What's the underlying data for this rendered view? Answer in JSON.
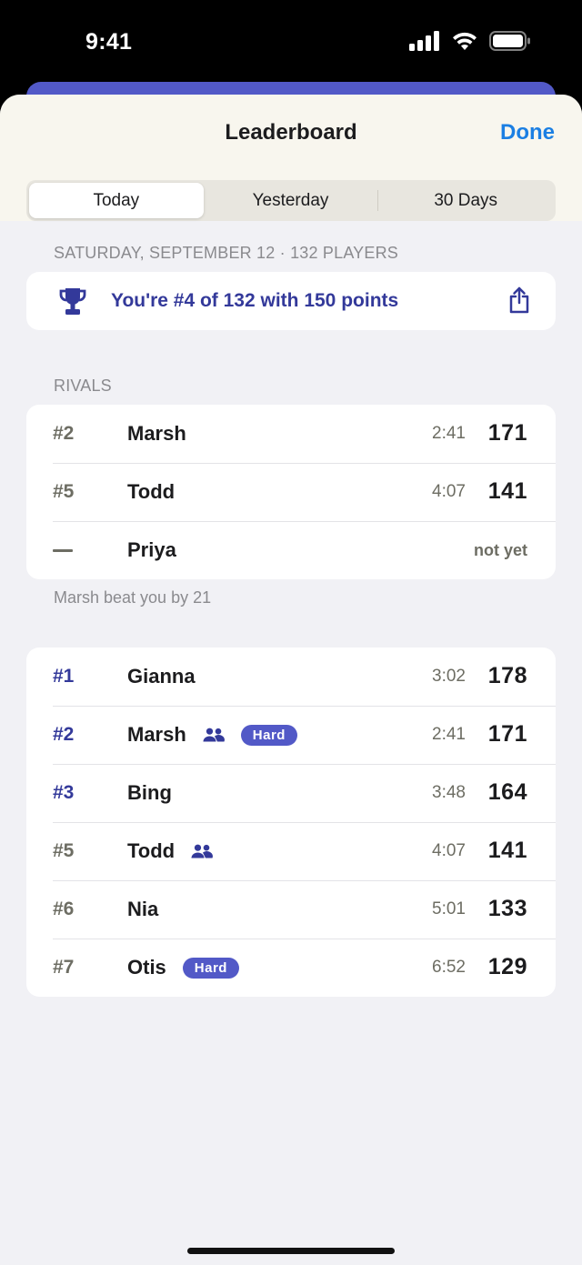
{
  "status_bar": {
    "time": "9:41"
  },
  "header": {
    "title": "Leaderboard",
    "done_label": "Done"
  },
  "tabs": [
    {
      "label": "Today",
      "selected": true
    },
    {
      "label": "Yesterday",
      "selected": false
    },
    {
      "label": "30 Days",
      "selected": false
    }
  ],
  "date_line": "SATURDAY, SEPTEMBER 12 · 132 PLAYERS",
  "summary": {
    "text": "You're #4 of 132 with 150 points"
  },
  "rivals": {
    "label": "RIVALS",
    "rows": [
      {
        "rank": "#2",
        "name": "Marsh",
        "time": "2:41",
        "score": "171"
      },
      {
        "rank": "#5",
        "name": "Todd",
        "time": "4:07",
        "score": "141"
      },
      {
        "rank": "",
        "name": "Priya",
        "status": "not yet"
      }
    ],
    "footnote": "Marsh beat you by 21"
  },
  "leaders": [
    {
      "rank": "#1",
      "name": "Gianna",
      "time": "3:02",
      "score": "178"
    },
    {
      "rank": "#2",
      "name": "Marsh",
      "friend": true,
      "badge": "Hard",
      "time": "2:41",
      "score": "171"
    },
    {
      "rank": "#3",
      "name": "Bing",
      "time": "3:48",
      "score": "164"
    },
    {
      "rank": "#5",
      "name": "Todd",
      "friend": true,
      "time": "4:07",
      "score": "141"
    },
    {
      "rank": "#6",
      "name": "Nia",
      "time": "5:01",
      "score": "133"
    },
    {
      "rank": "#7",
      "name": "Otis",
      "badge": "Hard",
      "time": "6:52",
      "score": "129"
    }
  ],
  "colors": {
    "accent": "#33399a",
    "badge": "#5259c7",
    "link": "#1b7fe3"
  }
}
